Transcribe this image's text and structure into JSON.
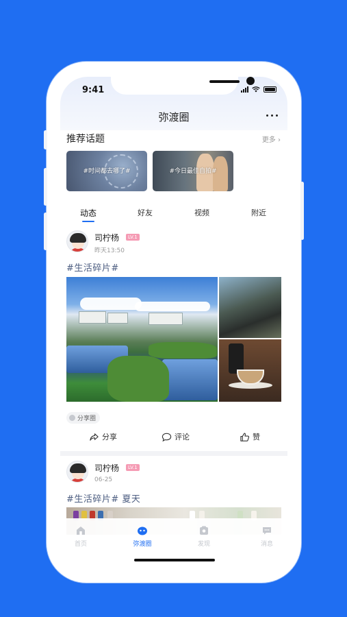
{
  "status_bar": {
    "time": "9:41"
  },
  "nav": {
    "title": "弥渡圈"
  },
  "topics": {
    "title": "推荐话题",
    "more": "更多",
    "items": [
      {
        "label": "#时间都去哪了#"
      },
      {
        "label": "#今日最佳自拍#"
      }
    ]
  },
  "feed_tabs": [
    "动态",
    "好友",
    "视频",
    "附近"
  ],
  "posts": [
    {
      "user": "司柠杨",
      "level": "LV.1",
      "time": "昨天13:50",
      "tag": "#生活碎片#",
      "circle": "分享圈",
      "actions": {
        "share": "分享",
        "comment": "评论",
        "like": "赞"
      }
    },
    {
      "user": "司柠杨",
      "level": "LV.1",
      "time": "06-25",
      "tag": "#生活碎片# 夏天"
    }
  ],
  "tabbar": [
    {
      "label": "首页",
      "icon": "home-icon",
      "active": false
    },
    {
      "label": "弥渡圈",
      "icon": "circle-icon",
      "active": true
    },
    {
      "label": "发现",
      "icon": "discover-icon",
      "active": false
    },
    {
      "label": "消息",
      "icon": "message-icon",
      "active": false
    }
  ],
  "colors": {
    "background": "#1f6ef2",
    "accent": "#1f6ef2",
    "badge": "#f59bb4"
  }
}
